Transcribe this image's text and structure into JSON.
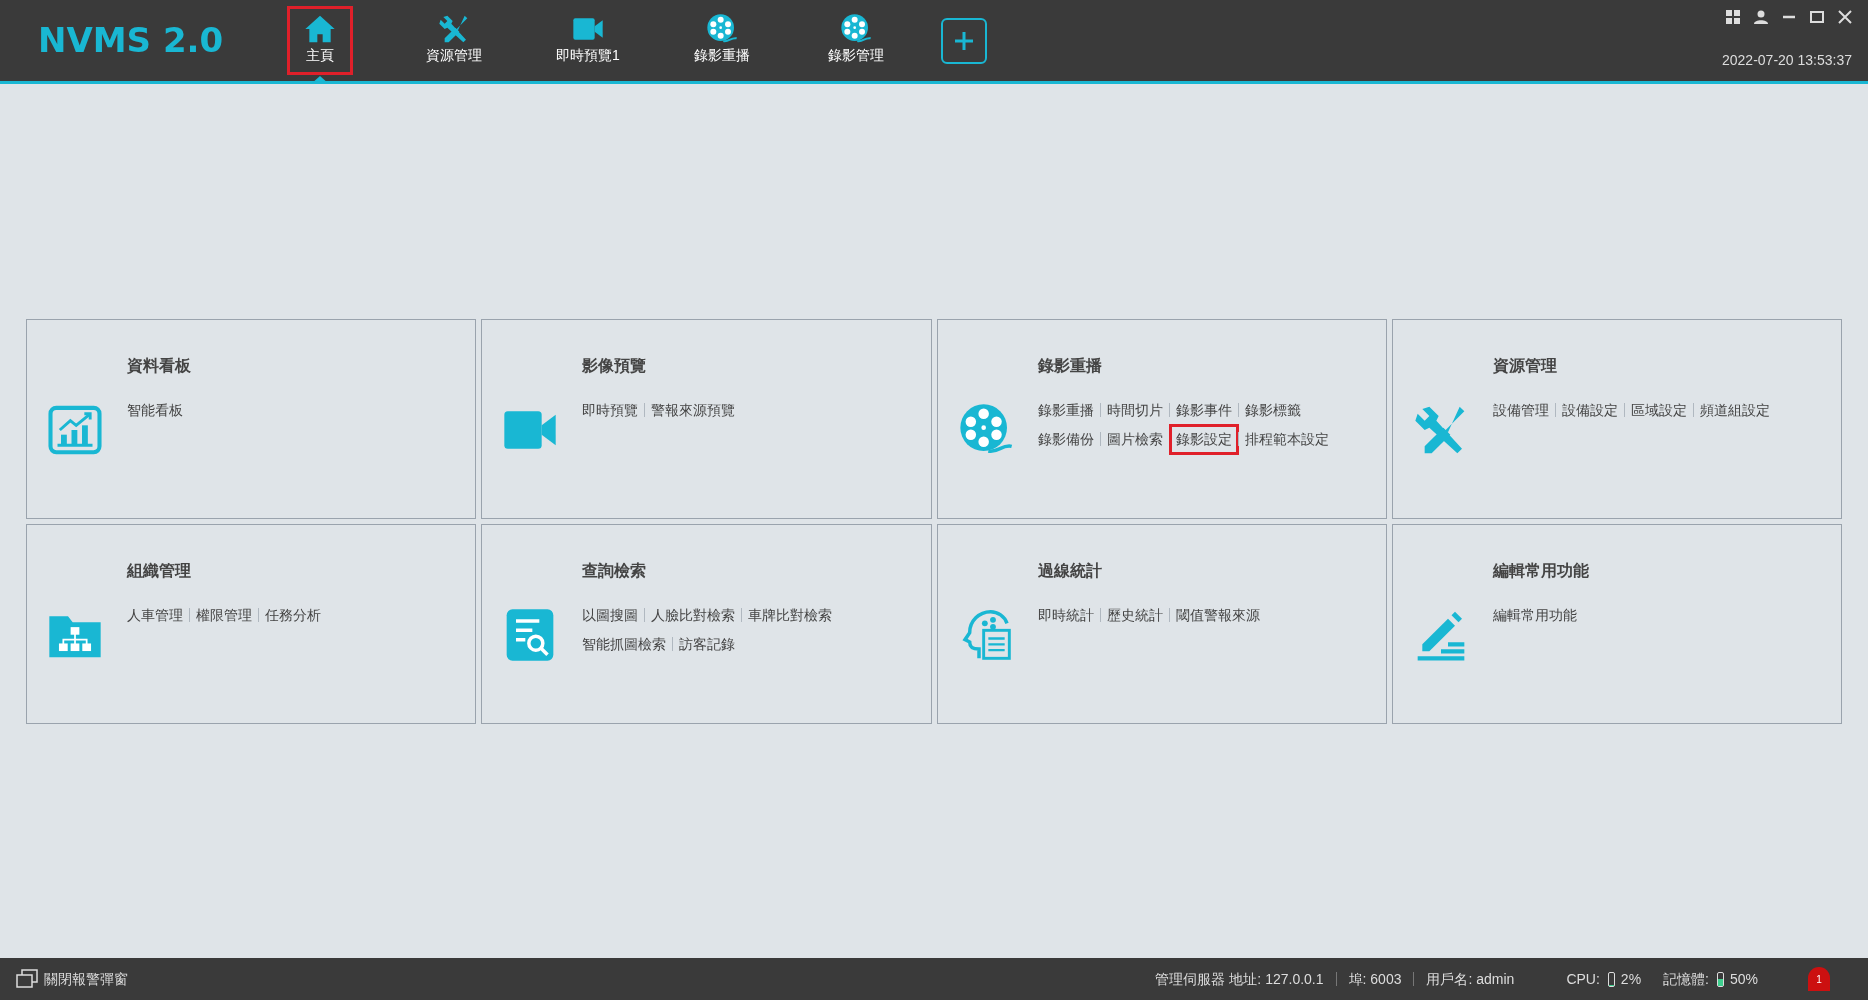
{
  "app": {
    "logo": "NVMS 2.0",
    "datetime": "2022-07-20 13:53:37"
  },
  "nav": [
    {
      "label": "主頁",
      "kind": "home",
      "selected": true,
      "highlighted": true
    },
    {
      "label": "資源管理",
      "kind": "tools",
      "selected": false,
      "highlighted": false
    },
    {
      "label": "即時預覽1",
      "kind": "camera",
      "selected": false,
      "highlighted": false
    },
    {
      "label": "錄影重播",
      "kind": "film",
      "selected": false,
      "highlighted": false
    },
    {
      "label": "錄影管理",
      "kind": "film",
      "selected": false,
      "highlighted": false
    }
  ],
  "cards": [
    {
      "title": "資料看板",
      "kind": "chart",
      "lines": [
        [
          {
            "label": "智能看板",
            "highlighted": false
          }
        ]
      ]
    },
    {
      "title": "影像預覽",
      "kind": "camera",
      "lines": [
        [
          {
            "label": "即時預覽",
            "highlighted": false
          },
          {
            "label": "警報來源預覽",
            "highlighted": false
          }
        ]
      ]
    },
    {
      "title": "錄影重播",
      "kind": "film",
      "lines": [
        [
          {
            "label": "錄影重播",
            "highlighted": false
          },
          {
            "label": "時間切片",
            "highlighted": false
          },
          {
            "label": "錄影事件",
            "highlighted": false
          },
          {
            "label": "錄影標籤",
            "highlighted": false
          }
        ],
        [
          {
            "label": "錄影備份",
            "highlighted": false
          },
          {
            "label": "圖片檢索",
            "highlighted": false
          },
          {
            "label": "錄影設定",
            "highlighted": true
          },
          {
            "label": "排程範本設定",
            "highlighted": false
          }
        ]
      ]
    },
    {
      "title": "資源管理",
      "kind": "tools",
      "lines": [
        [
          {
            "label": "設備管理",
            "highlighted": false
          },
          {
            "label": "設備設定",
            "highlighted": false
          },
          {
            "label": "區域設定",
            "highlighted": false
          },
          {
            "label": "頻道組設定",
            "highlighted": false
          }
        ]
      ]
    },
    {
      "title": "組織管理",
      "kind": "folder",
      "lines": [
        [
          {
            "label": "人車管理",
            "highlighted": false
          },
          {
            "label": "權限管理",
            "highlighted": false
          },
          {
            "label": "任務分析",
            "highlighted": false
          }
        ]
      ]
    },
    {
      "title": "查詢檢索",
      "kind": "search-doc",
      "lines": [
        [
          {
            "label": "以圖搜圖",
            "highlighted": false
          },
          {
            "label": "人臉比對檢索",
            "highlighted": false
          },
          {
            "label": "車牌比對檢索",
            "highlighted": false
          }
        ],
        [
          {
            "label": "智能抓圖檢索",
            "highlighted": false
          },
          {
            "label": "訪客記錄",
            "highlighted": false
          }
        ]
      ]
    },
    {
      "title": "過線統計",
      "kind": "head",
      "lines": [
        [
          {
            "label": "即時統計",
            "highlighted": false
          },
          {
            "label": "歷史統計",
            "highlighted": false
          },
          {
            "label": "閾值警報來源",
            "highlighted": false
          }
        ]
      ]
    },
    {
      "title": "編輯常用功能",
      "kind": "edit",
      "lines": [
        [
          {
            "label": "編輯常用功能",
            "highlighted": false
          }
        ]
      ]
    }
  ],
  "status_bar": {
    "close_alarm_popup": "關閉報警彈窗",
    "server": "管理伺服器 地址: 127.0.0.1",
    "port": "埠: 6003",
    "user": "用戶名: admin",
    "cpu_label": "CPU:",
    "cpu": {
      "level": 0.02,
      "reading": "2%"
    },
    "memory_label": "記憶體:",
    "memory": {
      "level": 0.5,
      "reading": "50%"
    },
    "alarm_count": "1"
  }
}
